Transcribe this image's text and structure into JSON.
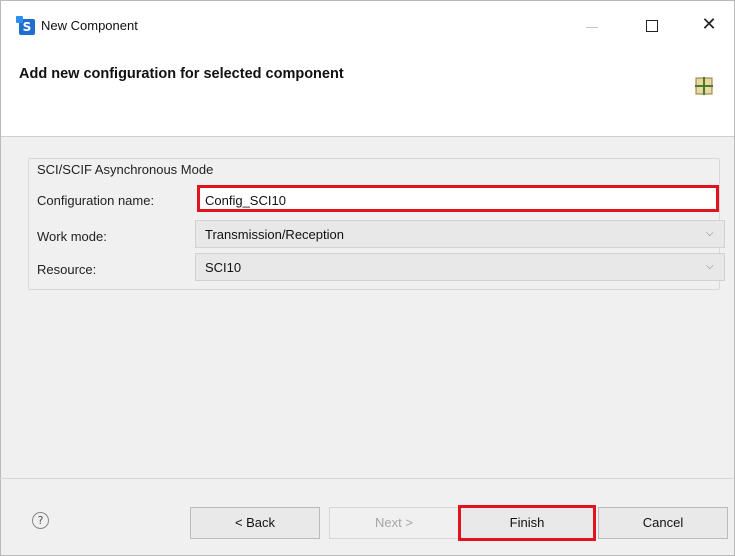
{
  "window": {
    "title": "New Component",
    "app_icon": "renesas-smart-configurator-icon",
    "app_icon_letter": "S"
  },
  "header": {
    "title": "Add new configuration for selected component",
    "icon": "component-grid-icon"
  },
  "group": {
    "label": "SCI/SCIF Asynchronous Mode",
    "fields": [
      {
        "label": "Configuration name:",
        "value": "Config_SCI10"
      },
      {
        "label": "Work mode:",
        "value": "Transmission/Reception"
      },
      {
        "label": "Resource:",
        "value": "SCI10"
      }
    ]
  },
  "buttons": {
    "back": "< Back",
    "next": "Next >",
    "finish": "Finish",
    "cancel": "Cancel"
  },
  "help_glyph": "?",
  "colors": {
    "highlight": "#e0141e",
    "dialog_bg": "#f0f0f0"
  }
}
